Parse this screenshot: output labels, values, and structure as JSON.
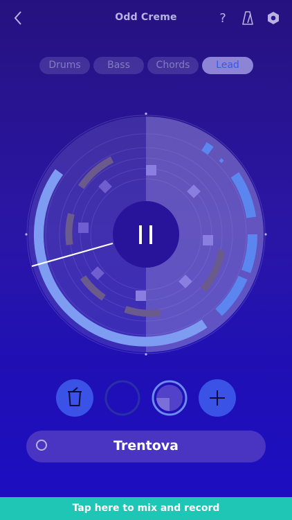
{
  "header": {
    "title": "Odd Creme",
    "icons": {
      "back": "chevron-left-icon",
      "help": "question-icon",
      "help_glyph": "?",
      "metronome": "metronome-icon",
      "settings": "hexagon-settings-icon"
    }
  },
  "tabs": [
    {
      "label": "Drums",
      "active": false
    },
    {
      "label": "Bass",
      "active": false
    },
    {
      "label": "Chords",
      "active": false
    },
    {
      "label": "Lead",
      "active": true
    }
  ],
  "sequencer": {
    "state": "playing",
    "control_icon": "pause-icon",
    "colors": {
      "lead": "#5b86f0",
      "lead_light": "#7e9cf2",
      "chords": "#6b5a8c",
      "drums": "#6e5ed0"
    }
  },
  "controls": {
    "delete_icon": "trash-icon",
    "add_icon": "plus-icon",
    "slot_empty_icon": "empty-ring-icon",
    "slot_progress_icon": "loop-progress-icon",
    "progress": 0.25
  },
  "preset": {
    "name": "Trentova",
    "icon": "circle-outline-icon"
  },
  "cta": {
    "label": "Tap here to mix and record"
  },
  "colors": {
    "accent": "#1fc6b6",
    "tab_active_text": "#2f5cf0",
    "preset_bg": "#4a35c3"
  }
}
